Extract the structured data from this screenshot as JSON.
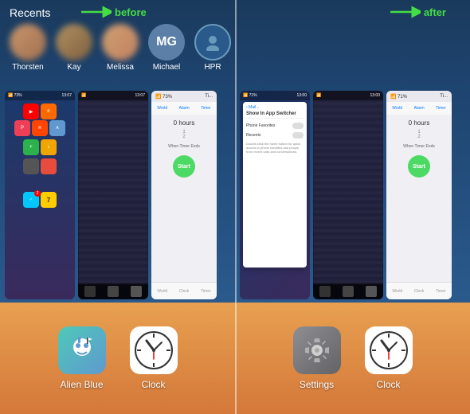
{
  "header": {
    "before_label": "before",
    "after_label": "after",
    "recents_label": "Recents"
  },
  "contacts": [
    {
      "name": "Thorsten",
      "type": "blurred"
    },
    {
      "name": "Kay",
      "type": "blurred"
    },
    {
      "name": "Melissa",
      "type": "blurred"
    },
    {
      "name": "Michael",
      "type": "initials",
      "initials": "MG"
    },
    {
      "name": "HPR",
      "type": "outline"
    }
  ],
  "dock_left": [
    {
      "label": "Alien Blue",
      "icon": "alien-blue"
    },
    {
      "label": "Clock",
      "icon": "clock"
    }
  ],
  "dock_right": [
    {
      "label": "Settings",
      "icon": "settings"
    },
    {
      "label": "Clock",
      "icon": "clock"
    }
  ],
  "timer": {
    "hours_label": "0 hours",
    "lines": [
      "1",
      "2"
    ],
    "when_ends": "When Timer Ends",
    "start_btn": "Start"
  },
  "settings_popup": {
    "title": "Show In App Switcher",
    "items": [
      {
        "label": "Phone Favorites"
      },
      {
        "label": "Recents"
      }
    ],
    "description": "Double-click the home button for quick access to phone favorites and people from recent calls and conversations."
  }
}
